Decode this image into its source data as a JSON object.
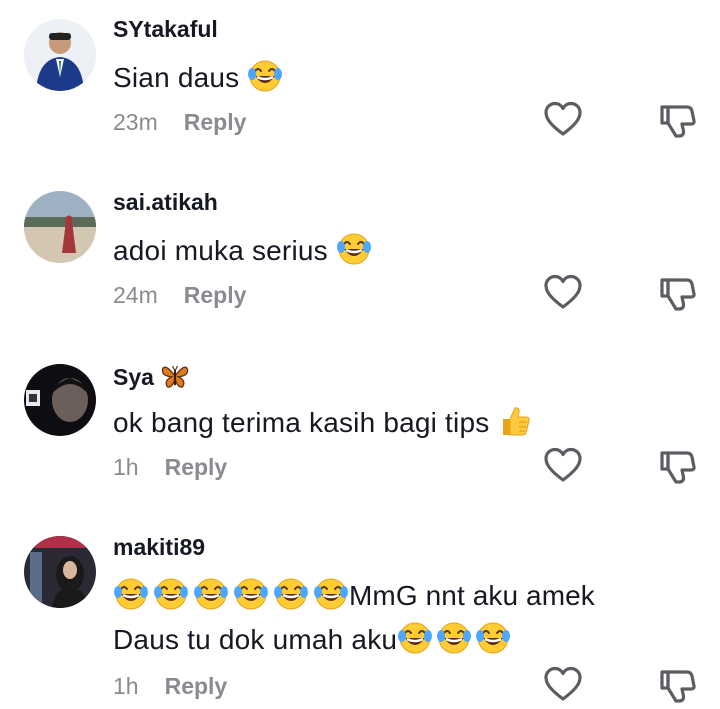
{
  "comments": [
    {
      "username": "SYtakaful",
      "text": "Sian daus",
      "time": "23m",
      "reply_label": "Reply",
      "avatar_icon": "user-avatar",
      "emojis": [
        "face-with-tears-of-joy"
      ]
    },
    {
      "username": "sai.atikah",
      "text": "adoi muka serius",
      "time": "24m",
      "reply_label": "Reply",
      "avatar_icon": "user-avatar",
      "emojis": [
        "face-with-tears-of-joy"
      ]
    },
    {
      "username": "Sya",
      "username_emoji": "butterfly",
      "text": "ok bang terima kasih bagi tips",
      "time": "1h",
      "reply_label": "Reply",
      "avatar_icon": "user-avatar",
      "emojis": [
        "thumbs-up"
      ]
    },
    {
      "username": "makiti89",
      "text_prefix_emojis": [
        "face-with-tears-of-joy",
        "face-with-tears-of-joy",
        "face-with-tears-of-joy",
        "face-with-tears-of-joy",
        "face-with-tears-of-joy",
        "face-with-tears-of-joy"
      ],
      "text_line1": "MmG nnt aku amek",
      "text_line2": "Daus tu dok umah aku",
      "text_line2_emojis": [
        "face-with-tears-of-joy",
        "face-with-tears-of-joy",
        "face-with-tears-of-joy"
      ],
      "time": "1h",
      "reply_label": "Reply",
      "avatar_icon": "user-avatar"
    }
  ],
  "icons": {
    "like": "heart-outline-icon",
    "dislike": "thumbs-down-outline-icon"
  }
}
